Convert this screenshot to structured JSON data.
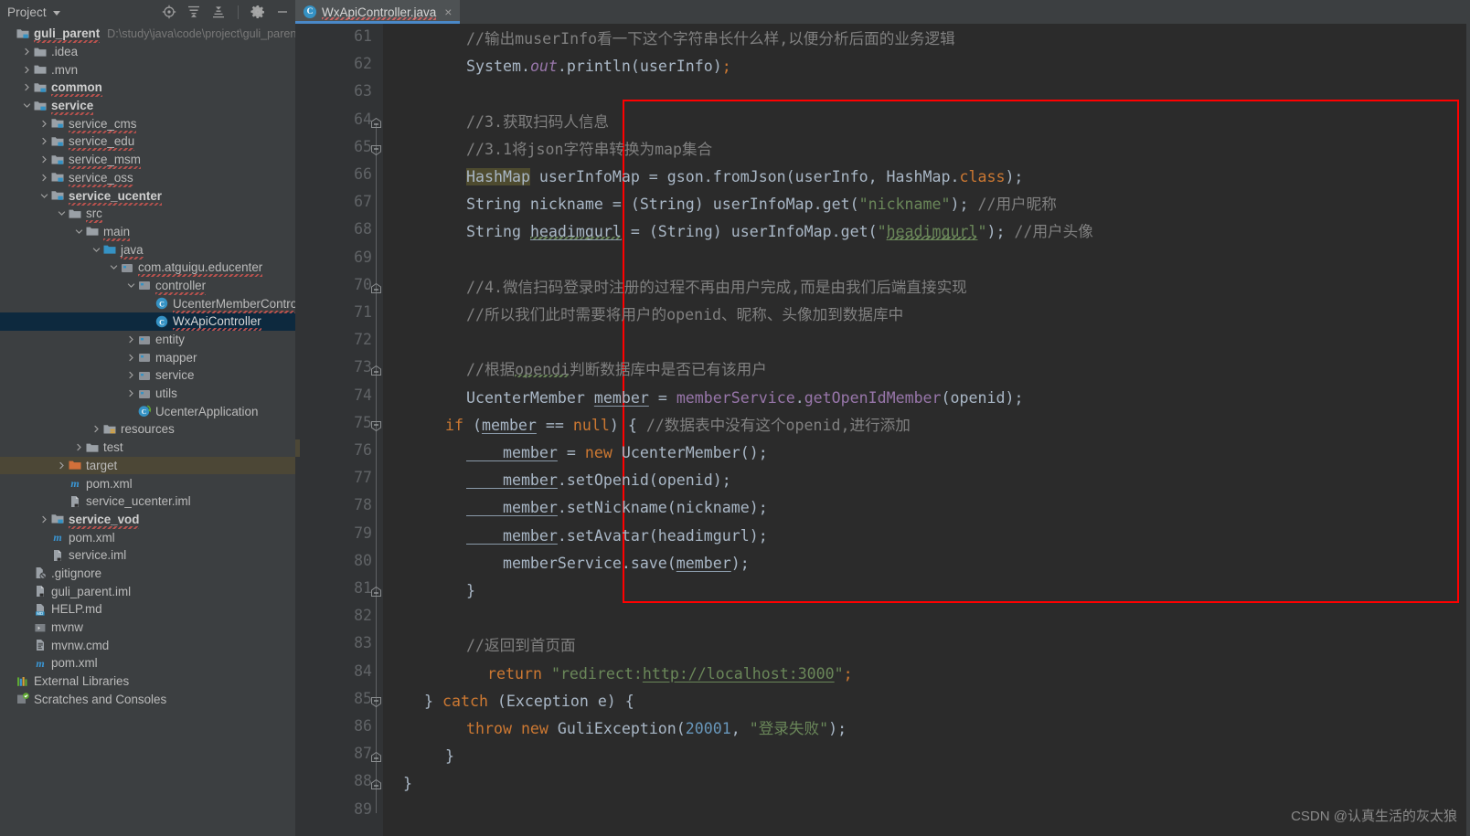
{
  "window": {
    "project_panel_title": "Project",
    "toolbar_icons": [
      "locate-icon",
      "expand-all-icon",
      "collapse-all-icon",
      "gear-icon",
      "minimize-icon"
    ]
  },
  "tabs": [
    {
      "label": "WxApiController.java",
      "icon": "java-class-icon",
      "active": true,
      "close_label": "×"
    }
  ],
  "tree": [
    {
      "depth": 0,
      "arrow": "none",
      "icon": "module-folder-icon",
      "name": "guli_parent",
      "bold": true,
      "squiggle": true,
      "path": "D:\\study\\java\\code\\project\\guli_parent"
    },
    {
      "depth": 1,
      "arrow": "right",
      "icon": "folder-icon",
      "name": ".idea"
    },
    {
      "depth": 1,
      "arrow": "right",
      "icon": "folder-icon",
      "name": ".mvn"
    },
    {
      "depth": 1,
      "arrow": "right",
      "icon": "module-folder-icon",
      "name": "common",
      "bold": true,
      "squiggle": true
    },
    {
      "depth": 1,
      "arrow": "down",
      "icon": "module-folder-icon",
      "name": "service",
      "bold": true,
      "squiggle": true
    },
    {
      "depth": 2,
      "arrow": "right",
      "icon": "module-folder-icon",
      "name": "service_cms",
      "squiggle": true
    },
    {
      "depth": 2,
      "arrow": "right",
      "icon": "module-folder-icon",
      "name": "service_edu",
      "squiggle": true
    },
    {
      "depth": 2,
      "arrow": "right",
      "icon": "module-folder-icon",
      "name": "service_msm",
      "squiggle": true
    },
    {
      "depth": 2,
      "arrow": "right",
      "icon": "module-folder-icon",
      "name": "service_oss",
      "squiggle": true
    },
    {
      "depth": 2,
      "arrow": "down",
      "icon": "module-folder-icon",
      "name": "service_ucenter",
      "bold": true,
      "squiggle": true
    },
    {
      "depth": 3,
      "arrow": "down",
      "icon": "folder-icon",
      "name": "src",
      "squiggle": true
    },
    {
      "depth": 4,
      "arrow": "down",
      "icon": "folder-icon",
      "name": "main",
      "squiggle": true
    },
    {
      "depth": 5,
      "arrow": "down",
      "icon": "source-folder-icon",
      "name": "java",
      "squiggle": true
    },
    {
      "depth": 6,
      "arrow": "down",
      "icon": "package-icon",
      "name": "com.atguigu.educenter",
      "squiggle": true
    },
    {
      "depth": 7,
      "arrow": "down",
      "icon": "package-icon",
      "name": "controller",
      "squiggle": true
    },
    {
      "depth": 8,
      "arrow": "none",
      "icon": "java-class-icon",
      "name": "UcenterMemberController",
      "squiggle": true
    },
    {
      "depth": 8,
      "arrow": "none",
      "icon": "java-class-icon",
      "name": "WxApiController",
      "selected": true,
      "squiggle": true
    },
    {
      "depth": 7,
      "arrow": "right",
      "icon": "package-icon",
      "name": "entity"
    },
    {
      "depth": 7,
      "arrow": "right",
      "icon": "package-icon",
      "name": "mapper"
    },
    {
      "depth": 7,
      "arrow": "right",
      "icon": "package-icon",
      "name": "service"
    },
    {
      "depth": 7,
      "arrow": "right",
      "icon": "package-icon",
      "name": "utils"
    },
    {
      "depth": 7,
      "arrow": "none",
      "icon": "spring-boot-class-icon",
      "name": "UcenterApplication"
    },
    {
      "depth": 5,
      "arrow": "right",
      "icon": "resources-folder-icon",
      "name": "resources"
    },
    {
      "depth": 4,
      "arrow": "right",
      "icon": "folder-icon",
      "name": "test"
    },
    {
      "depth": 3,
      "arrow": "right",
      "icon": "target-folder-icon",
      "name": "target",
      "highlight": true
    },
    {
      "depth": 3,
      "arrow": "none",
      "icon": "maven-icon",
      "name": "pom.xml"
    },
    {
      "depth": 3,
      "arrow": "none",
      "icon": "iml-icon",
      "name": "service_ucenter.iml"
    },
    {
      "depth": 2,
      "arrow": "right",
      "icon": "module-folder-icon",
      "name": "service_vod",
      "bold": true,
      "squiggle": true
    },
    {
      "depth": 2,
      "arrow": "none",
      "icon": "maven-icon",
      "name": "pom.xml"
    },
    {
      "depth": 2,
      "arrow": "none",
      "icon": "iml-icon",
      "name": "service.iml"
    },
    {
      "depth": 1,
      "arrow": "none",
      "icon": "gitignore-icon",
      "name": ".gitignore"
    },
    {
      "depth": 1,
      "arrow": "none",
      "icon": "iml-icon",
      "name": "guli_parent.iml"
    },
    {
      "depth": 1,
      "arrow": "none",
      "icon": "markdown-icon",
      "name": "HELP.md"
    },
    {
      "depth": 1,
      "arrow": "none",
      "icon": "script-icon",
      "name": "mvnw"
    },
    {
      "depth": 1,
      "arrow": "none",
      "icon": "cmd-file-icon",
      "name": "mvnw.cmd"
    },
    {
      "depth": 1,
      "arrow": "none",
      "icon": "maven-icon",
      "name": "pom.xml"
    },
    {
      "depth": 0,
      "arrow": "none",
      "icon": "libraries-icon",
      "name": "External Libraries"
    },
    {
      "depth": 0,
      "arrow": "none",
      "icon": "scratches-icon",
      "name": "Scratches and Consoles"
    }
  ],
  "editor": {
    "first_line_number": 61,
    "last_line_number": 89,
    "line_numbers": [
      61,
      62,
      63,
      64,
      65,
      66,
      67,
      68,
      69,
      70,
      71,
      72,
      73,
      74,
      75,
      76,
      77,
      78,
      79,
      80,
      81,
      82,
      83,
      84,
      85,
      86,
      87,
      88,
      89
    ],
    "lines": [
      {
        "n": 61,
        "text": "        //输出muserInfo看一下这个字符串长什么样,以便分析后面的业务逻辑"
      },
      {
        "n": 62,
        "text": "        System.out.println(userInfo);"
      },
      {
        "n": 63,
        "text": ""
      },
      {
        "n": 64,
        "text": "        //3.获取扫码人信息"
      },
      {
        "n": 65,
        "text": "        //3.1将json字符串转换为map集合"
      },
      {
        "n": 66,
        "text": "        HashMap userInfoMap = gson.fromJson(userInfo, HashMap.class);"
      },
      {
        "n": 67,
        "text": "        String nickname = (String) userInfoMap.get(\"nickname\"); //用户昵称"
      },
      {
        "n": 68,
        "text": "        String headimgurl = (String) userInfoMap.get(\"headimgurl\"); //用户头像"
      },
      {
        "n": 69,
        "text": ""
      },
      {
        "n": 70,
        "text": "        //4.微信扫码登录时注册的过程不再由用户完成,而是由我们后端直接实现"
      },
      {
        "n": 71,
        "text": "        //所以我们此时需要将用户的openid、昵称、头像加到数据库中"
      },
      {
        "n": 72,
        "text": ""
      },
      {
        "n": 73,
        "text": "        //根据opendi判断数据库中是否已有该用户"
      },
      {
        "n": 74,
        "text": "        UcenterMember member = memberService.getOpenIdMember(openid);"
      },
      {
        "n": 75,
        "text": "        if (member == null) { //数据表中没有这个openid,进行添加"
      },
      {
        "n": 76,
        "text": "            member = new UcenterMember();"
      },
      {
        "n": 77,
        "text": "            member.setOpenid(openid);"
      },
      {
        "n": 78,
        "text": "            member.setNickname(nickname);"
      },
      {
        "n": 79,
        "text": "            member.setAvatar(headimgurl);"
      },
      {
        "n": 80,
        "text": "            memberService.save(member);"
      },
      {
        "n": 81,
        "text": "        }"
      },
      {
        "n": 82,
        "text": ""
      },
      {
        "n": 83,
        "text": "        //返回到首页面"
      },
      {
        "n": 84,
        "text": "        return \"redirect:http://localhost:3000\";"
      },
      {
        "n": 85,
        "text": "    } catch (Exception e) {"
      },
      {
        "n": 86,
        "text": "        throw new GuliException(20001, \"登录失败\");"
      },
      {
        "n": 87,
        "text": "    }"
      },
      {
        "n": 88,
        "text": "}"
      },
      {
        "n": 89,
        "text": ""
      }
    ],
    "highlight_token": "HashMap",
    "red_annotation_box": {
      "from_line": 64,
      "to_line": 81,
      "color": "#ff0000"
    },
    "fold_markers": [
      64,
      65,
      70,
      73,
      75,
      81,
      85,
      87,
      88
    ]
  },
  "watermark": "CSDN @认真生活的灰太狼",
  "colors": {
    "panel_bg": "#3c3f41",
    "editor_bg": "#2b2b2b",
    "gutter_bg": "#313335",
    "selection": "#0d293e",
    "accent": "#4a88c7",
    "comment": "#808080",
    "keyword": "#cc7832",
    "string": "#6a8759",
    "number": "#6897bb",
    "field": "#9876aa",
    "default_text": "#a9b7c6",
    "annotation_red": "#ff0000",
    "target_highlight": "#4c4736"
  }
}
